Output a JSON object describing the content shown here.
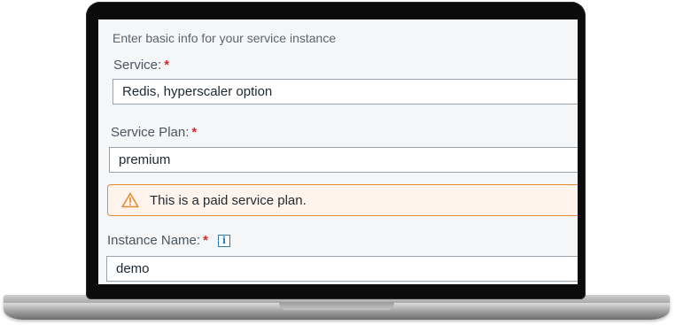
{
  "form": {
    "section_title": "Enter basic info for your service instance",
    "service": {
      "label": "Service:",
      "required_marker": "*",
      "value": "Redis, hyperscaler option"
    },
    "service_plan": {
      "label": "Service Plan:",
      "required_marker": "*",
      "value": "premium"
    },
    "warning": {
      "icon": "warning-triangle-icon",
      "text": "This is a paid service plan."
    },
    "instance_name": {
      "label": "Instance Name:",
      "required_marker": "*",
      "info_icon": "i",
      "value": "demo"
    }
  },
  "colors": {
    "required": "#d12c2c",
    "warning_border": "#e78c33",
    "warning_background": "#fff4ec",
    "info": "#2a7ab8"
  }
}
